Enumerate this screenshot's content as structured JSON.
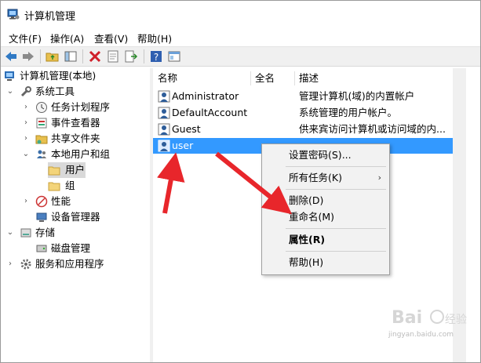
{
  "window": {
    "title": "计算机管理"
  },
  "menubar": [
    {
      "label": "文件(F)"
    },
    {
      "label": "操作(A)"
    },
    {
      "label": "查看(V)"
    },
    {
      "label": "帮助(H)"
    }
  ],
  "tree": {
    "root": "计算机管理(本地)",
    "items": [
      {
        "label": "系统工具"
      },
      {
        "label": "任务计划程序"
      },
      {
        "label": "事件查看器"
      },
      {
        "label": "共享文件夹"
      },
      {
        "label": "本地用户和组"
      },
      {
        "label": "用户"
      },
      {
        "label": "组"
      },
      {
        "label": "性能"
      },
      {
        "label": "设备管理器"
      },
      {
        "label": "存储"
      },
      {
        "label": "磁盘管理"
      },
      {
        "label": "服务和应用程序"
      }
    ]
  },
  "list": {
    "columns": [
      "名称",
      "全名",
      "描述"
    ],
    "rows": [
      {
        "name": "Administrator",
        "fullname": "",
        "desc": "管理计算机(域)的内置帐户"
      },
      {
        "name": "DefaultAccount",
        "fullname": "",
        "desc": "系统管理的用户帐户。"
      },
      {
        "name": "Guest",
        "fullname": "",
        "desc": "供来宾访问计算机或访问域的内..."
      },
      {
        "name": "user",
        "fullname": "",
        "desc": ""
      }
    ]
  },
  "context_menu": {
    "items": [
      {
        "label": "设置密码(S)..."
      },
      {
        "label": "所有任务(K)"
      },
      {
        "label": "删除(D)"
      },
      {
        "label": "重命名(M)"
      },
      {
        "label": "属性(R)"
      },
      {
        "label": "帮助(H)"
      }
    ]
  },
  "watermark": {
    "text": "jingyan.baidu.com"
  },
  "colors": {
    "selection": "#3399ff",
    "arrow": "#e8262b"
  },
  "icons": [
    "computer-management-icon",
    "back-icon",
    "forward-icon",
    "up-folder-icon",
    "show-hide-tree-icon",
    "delete-icon",
    "properties-icon",
    "export-icon",
    "help-icon",
    "console-icon",
    "user-icon",
    "group-icon",
    "folder-icon",
    "tools-icon",
    "clock-icon",
    "event-viewer-icon",
    "shared-folder-icon",
    "performance-icon",
    "device-manager-icon",
    "storage-icon",
    "disk-icon",
    "services-icon"
  ]
}
